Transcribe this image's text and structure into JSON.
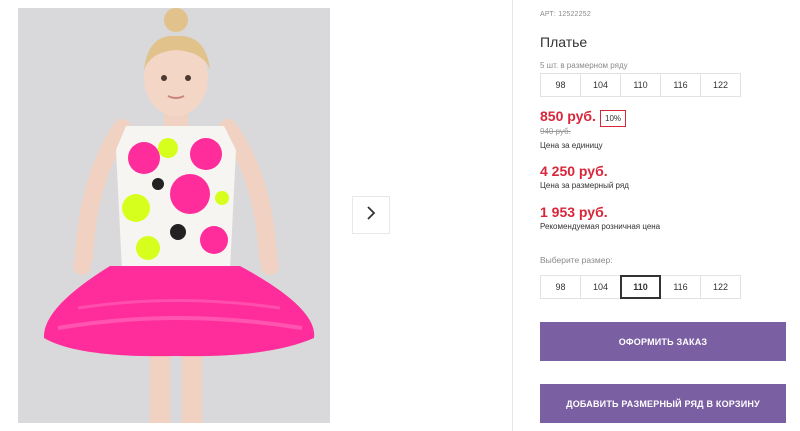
{
  "product": {
    "article": "АРТ: 12522252",
    "title": "Платье",
    "row_note": "5 шт. в размерном ряду",
    "row_sizes": [
      "98",
      "104",
      "110",
      "116",
      "122"
    ]
  },
  "prices": {
    "unit_price": "850 руб.",
    "discount": "10%",
    "old_price": "940 руб.",
    "unit_caption": "Цена за единицу",
    "row_price": "4 250 руб.",
    "row_caption": "Цена за размерный ряд",
    "retail_price": "1 953 руб.",
    "retail_caption": "Рекомендуемая розничная цена"
  },
  "size_select": {
    "label": "Выберите размер:",
    "options": [
      "98",
      "104",
      "110",
      "116",
      "122"
    ],
    "selected": "110"
  },
  "actions": {
    "order": "ОФОРМИТЬ ЗАКАЗ",
    "add_row": "ДОБАВИТЬ РАЗМЕРНЫЙ РЯД В КОРЗИНУ"
  },
  "colors": {
    "accent": "#7b5fa3",
    "price": "#d8263a",
    "dress_pink": "#ff2d9b",
    "neon_yellow": "#d7ff1e"
  },
  "icons": {
    "next": "chevron-right-icon"
  }
}
